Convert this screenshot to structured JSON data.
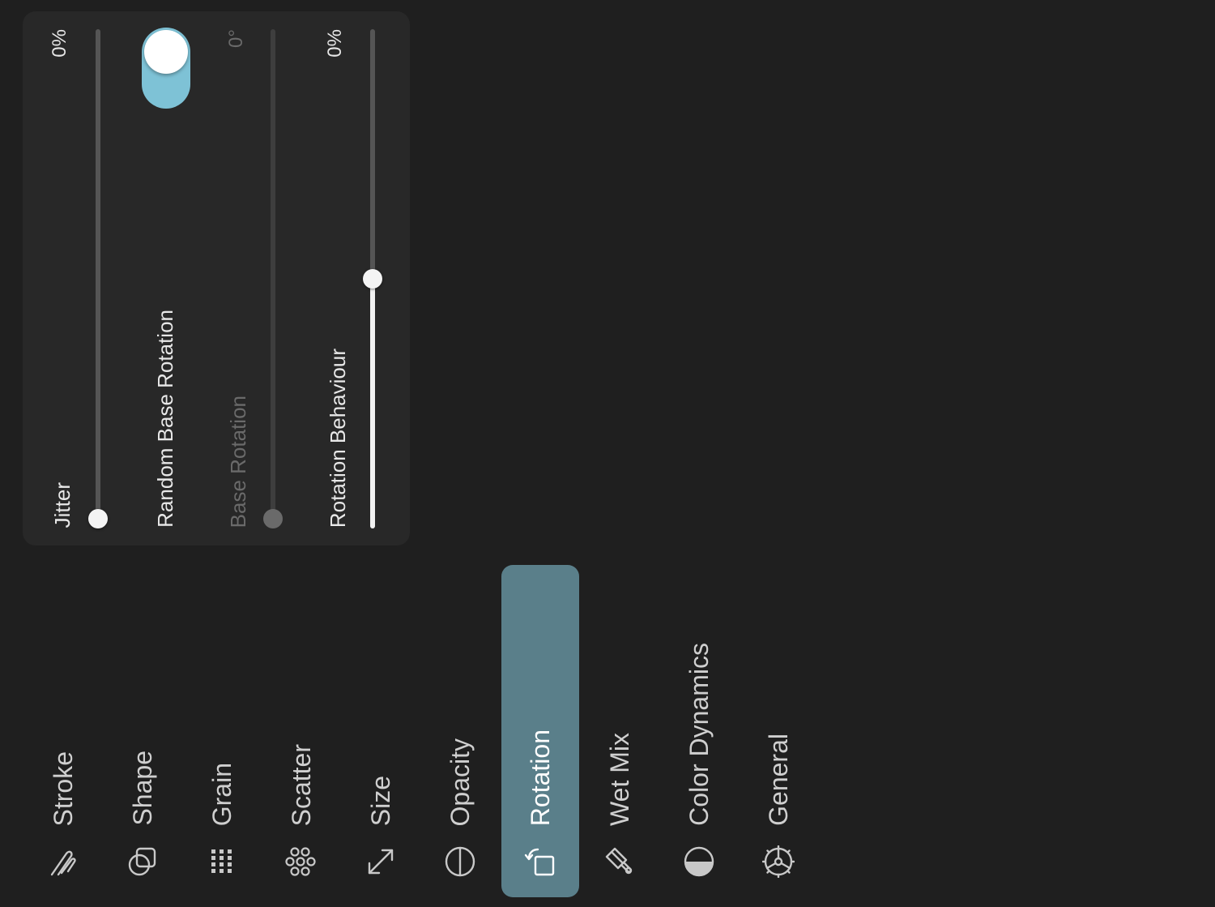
{
  "panel": {
    "jitter": {
      "label": "Jitter",
      "value": "0%",
      "fraction": 0.0
    },
    "random_base_rotation": {
      "label": "Random Base Rotation",
      "enabled": true
    },
    "base_rotation": {
      "label": "Base Rotation",
      "value": "0°",
      "disabled": true
    },
    "rotation_behaviour": {
      "label": "Rotation Behaviour",
      "value": "0%",
      "fraction": 0.5
    }
  },
  "menu": {
    "items": [
      {
        "label": "Stroke",
        "icon": "stroke-icon"
      },
      {
        "label": "Shape",
        "icon": "shape-icon"
      },
      {
        "label": "Grain",
        "icon": "grain-icon"
      },
      {
        "label": "Scatter",
        "icon": "scatter-icon"
      },
      {
        "label": "Size",
        "icon": "size-icon"
      },
      {
        "label": "Opacity",
        "icon": "opacity-icon"
      },
      {
        "label": "Rotation",
        "icon": "rotation-icon",
        "active": true
      },
      {
        "label": "Wet Mix",
        "icon": "wet-mix-icon"
      },
      {
        "label": "Color Dynamics",
        "icon": "color-dynamics-icon"
      },
      {
        "label": "General",
        "icon": "general-icon"
      }
    ]
  },
  "colors": {
    "background": "#1f1f1f",
    "panel": "#282828",
    "accent_toggle": "#7ec2d6",
    "active_tab": "#5a7f8a"
  }
}
